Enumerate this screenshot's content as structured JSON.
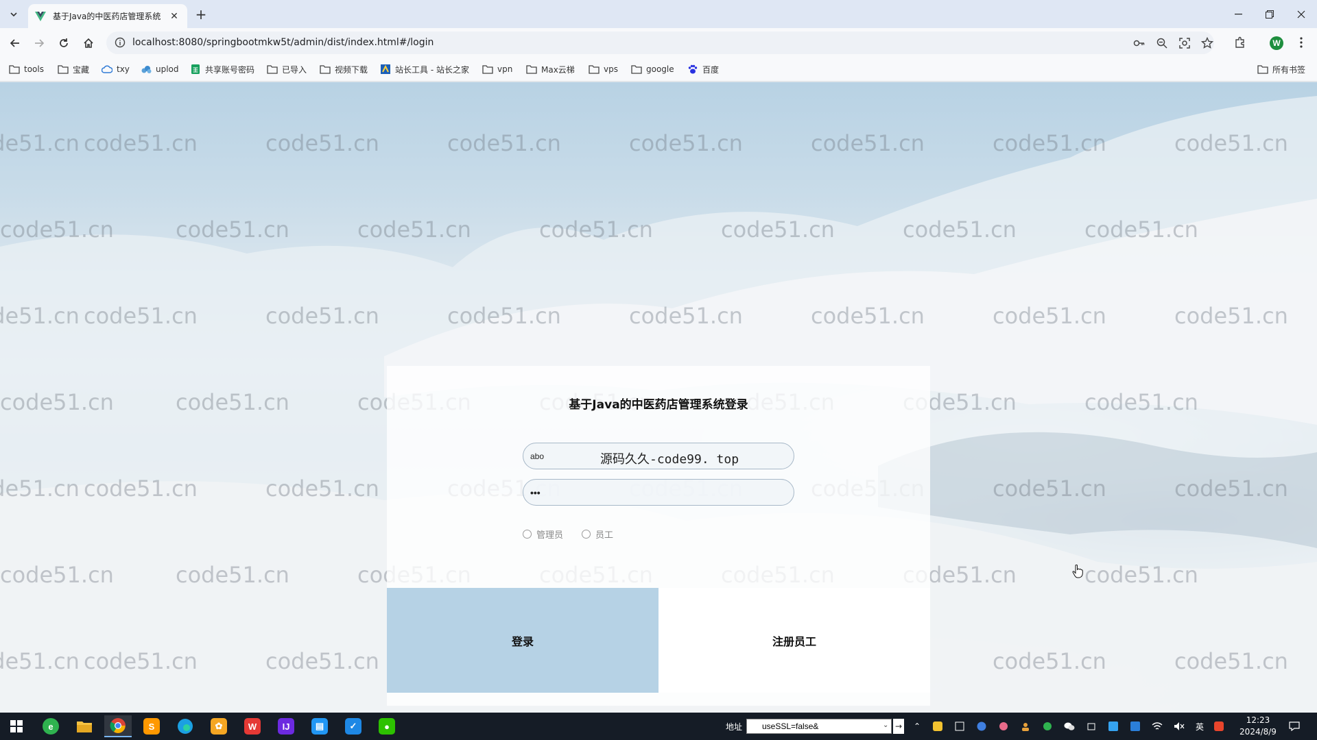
{
  "browser": {
    "tab_title": "基于Java的中医药店管理系统",
    "url": "localhost:8080/springbootmkw5t/admin/dist/index.html#/login",
    "profile_initial": "W",
    "bookmarks": [
      {
        "label": "tools",
        "icon": "folder-icon"
      },
      {
        "label": "宝藏",
        "icon": "folder-icon"
      },
      {
        "label": "txy",
        "icon": "cloud-icon"
      },
      {
        "label": "uplod",
        "icon": "upload-cloud-icon"
      },
      {
        "label": "共享账号密码",
        "icon": "sheet-icon"
      },
      {
        "label": "已导入",
        "icon": "folder-icon"
      },
      {
        "label": "视频下载",
        "icon": "folder-icon"
      },
      {
        "label": "站长工具 - 站长之家",
        "icon": "site-icon"
      },
      {
        "label": "vpn",
        "icon": "folder-icon"
      },
      {
        "label": "Max云梯",
        "icon": "folder-icon"
      },
      {
        "label": "vps",
        "icon": "folder-icon"
      },
      {
        "label": "google",
        "icon": "folder-icon"
      },
      {
        "label": "百度",
        "icon": "baidu-paw-icon"
      }
    ],
    "all_bookmarks": "所有书签"
  },
  "watermark": "code51.cn",
  "login": {
    "title": "基于Java的中医药店管理系统登录",
    "username_value": "abo",
    "password_value": "•••",
    "overlay_text": "源码久久-code99. top",
    "roles": [
      "管理员",
      "员工"
    ],
    "login_button": "登录",
    "register_button": "注册员工"
  },
  "taskbar": {
    "address_label": "地址",
    "address_value": "useSSL=false&",
    "ime": "英",
    "time": "12:23",
    "date": "2024/8/9"
  },
  "colors": {
    "login_button_bg": "#b6d2e5",
    "profile": "#1e8e3e",
    "taskbar_bg": "#151c26"
  }
}
